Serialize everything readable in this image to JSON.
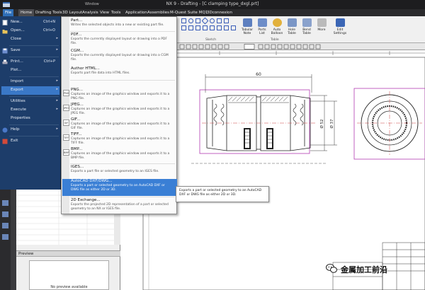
{
  "window": {
    "title": "NX 9 - Drafting - [C clamping type_dxgl.prt]",
    "windows_menu": "Window"
  },
  "menubar": {
    "tabs": [
      "File",
      "Home",
      "Drafting Tools",
      "3D Layout",
      "Analysis",
      "View",
      "Tools",
      "Application",
      "Assemblies",
      "M-Quest Suite MQ1",
      "3Dconnexion"
    ]
  },
  "ribbon": {
    "buttons": [
      {
        "label": "Tabular Note",
        "icon": "tabular-note-icon"
      },
      {
        "label": "Parts List",
        "icon": "parts-list-icon"
      },
      {
        "label": "Auto Balloon",
        "icon": "auto-balloon-icon"
      },
      {
        "label": "Hole Table",
        "icon": "hole-table-icon"
      },
      {
        "label": "Bend Table",
        "icon": "bend-table-icon"
      },
      {
        "label": "More",
        "icon": "more-icon"
      },
      {
        "label": "Edit Settings",
        "icon": "edit-settings-icon"
      }
    ],
    "groups": [
      "Sketch",
      "Table"
    ]
  },
  "file_menu": {
    "items": [
      {
        "label": "New...",
        "shortcut": "Ctrl+N",
        "icon": "new-icon"
      },
      {
        "label": "Open...",
        "shortcut": "Ctrl+O",
        "icon": "open-icon"
      },
      {
        "label": "Close",
        "shortcut": "",
        "icon": "close-icon",
        "arrow": true
      },
      {
        "label": "Save",
        "shortcut": "",
        "icon": "save-icon",
        "arrow": true
      },
      {
        "label": "Print...",
        "shortcut": "Ctrl+P",
        "icon": "print-icon"
      },
      {
        "label": "Plot...",
        "shortcut": "",
        "icon": "plot-icon"
      },
      {
        "label": "Import",
        "shortcut": "",
        "icon": "import-icon",
        "arrow": true
      },
      {
        "label": "Export",
        "shortcut": "",
        "icon": "export-icon",
        "arrow": true
      },
      {
        "label": "Utilities",
        "shortcut": "",
        "icon": "utilities-icon",
        "arrow": true
      },
      {
        "label": "Execute",
        "shortcut": "",
        "icon": "execute-icon",
        "arrow": true
      },
      {
        "label": "Properties",
        "shortcut": "",
        "icon": "properties-icon"
      },
      {
        "label": "Help",
        "shortcut": "",
        "icon": "help-icon",
        "arrow": true
      },
      {
        "label": "Exit",
        "shortcut": "",
        "icon": "exit-icon"
      }
    ]
  },
  "export_submenu": {
    "items": [
      {
        "title": "Part...",
        "desc": "Writes the selected objects into a new or existing part file.",
        "icon": ""
      },
      {
        "title": "PDF...",
        "desc": "Exports the currently displayed layout or drawing into a PDF file.",
        "icon": ""
      },
      {
        "title": "CGM...",
        "desc": "Exports the currently displayed layout or drawing into a CGM file.",
        "icon": ""
      },
      {
        "title": "Author HTML...",
        "desc": "Exports part file data into HTML files.",
        "icon": ""
      },
      {
        "title": "PNG...",
        "desc": "Captures an image of the graphics window and exports it to a PNG file.",
        "icon": "PNG"
      },
      {
        "title": "JPEG...",
        "desc": "Captures an image of the graphics window and exports it to a JPEG file.",
        "icon": "JPEG"
      },
      {
        "title": "GIF...",
        "desc": "Captures an image of the graphics window and exports it to a GIF file.",
        "icon": "GIF"
      },
      {
        "title": "TIFF...",
        "desc": "Captures an image of the graphics window and exports it to a TIFF file.",
        "icon": "TIFF"
      },
      {
        "title": "BMP...",
        "desc": "Captures an image of the graphics window and exports it to a BMP file.",
        "icon": "BMP"
      },
      {
        "title": "IGES...",
        "desc": "Exports a part file or selected geometry to an IGES file.",
        "icon": ""
      },
      {
        "title": "AutoCAD DXF/DWG...",
        "desc": "Exports a part or selected geometry to an AutoCAD DXF or DWG file as either 2D or 3D.",
        "icon": ""
      },
      {
        "title": "2D Exchange...",
        "desc": "Exports the projected 2D representation of a part or selected geometry to an NX or IGES file.",
        "icon": ""
      }
    ]
  },
  "tooltip": {
    "text": "Exports a part or selected geometry to an AutoCAD DXF or DWG file as either 2D or 3D."
  },
  "preview": {
    "header": "Preview",
    "empty_text": "No preview available"
  },
  "drawing": {
    "dim_width": "60",
    "dim_dia1": "Ø 52",
    "dim_dia2": "Ø 37"
  },
  "watermark": {
    "text": "金属加工前沿",
    "icon": "wechat-icon"
  },
  "colors": {
    "file_menu_bg": "#1d3d6a",
    "menu_highlight": "#3a7fd5",
    "titlebar": "#1d1d1f"
  }
}
